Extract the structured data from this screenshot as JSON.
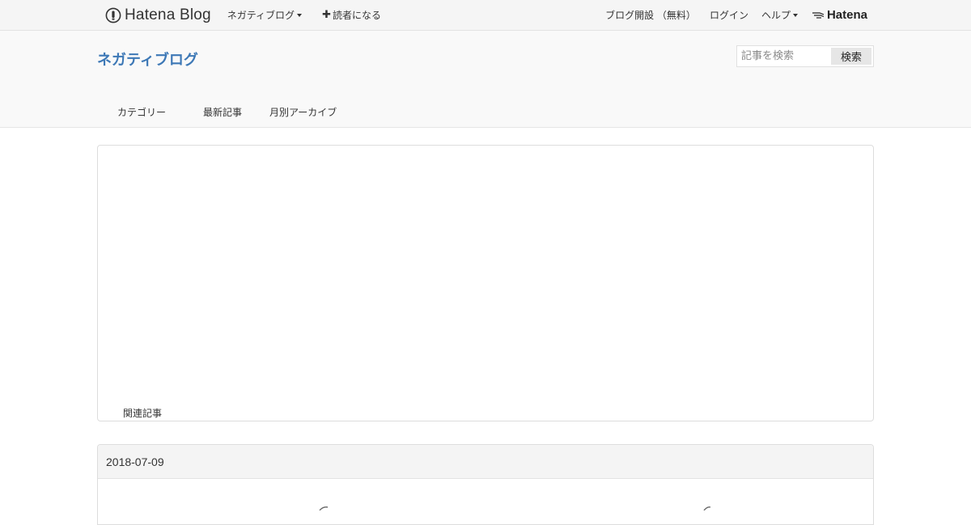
{
  "globalbar": {
    "logo_text": "Hatena Blog",
    "blog_menu_label": "ネガティブログ",
    "subscribe_label": "読者になる",
    "subscribe_prefix": "✚",
    "open_blog_label": "ブログ開設 （無料）",
    "login_label": "ログイン",
    "help_label": "ヘルプ",
    "hatena_logo_text": "Hatena"
  },
  "header": {
    "blog_title": "ネガティブログ",
    "search": {
      "placeholder": "記事を検索",
      "value": "",
      "button_label": "検索"
    },
    "nav": [
      {
        "label": "カテゴリー"
      },
      {
        "label": "最新記事"
      },
      {
        "label": "月別アーカイブ"
      }
    ]
  },
  "main": {
    "related_label": "関連記事",
    "entry": {
      "date": "2018-07-09"
    }
  },
  "colors": {
    "accent": "#3d78b6",
    "bar_bg": "#f5f5f5",
    "header_bg": "#f9f9f9"
  },
  "icons": {
    "blog_logo": "hatena-blog-logo-icon",
    "hatena_logo": "hatena-bird-icon"
  }
}
